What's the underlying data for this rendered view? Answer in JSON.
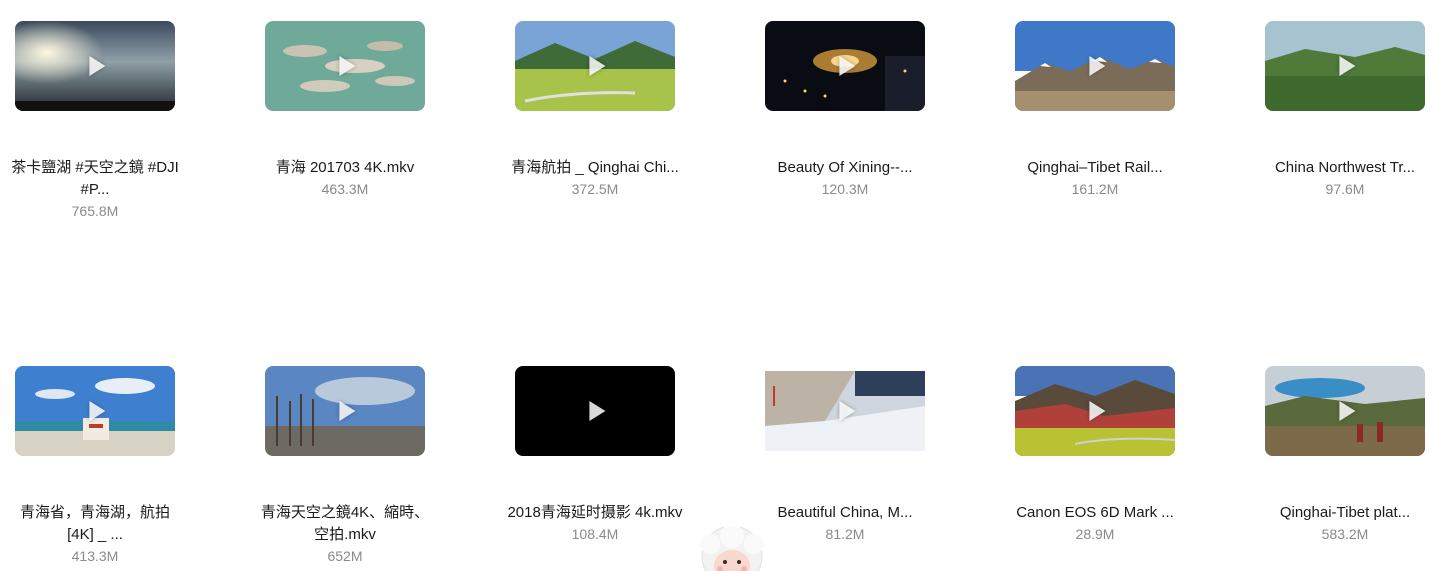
{
  "files": [
    {
      "title": "茶卡鹽湖 #天空之鏡 #DJI #P...",
      "size": "765.8M",
      "thumb": "thumb-salt-lake"
    },
    {
      "title": "青海 201703 4K.mkv",
      "size": "463.3M",
      "thumb": "thumb-lake-islands"
    },
    {
      "title": "青海航拍 _ Qinghai Chi...",
      "size": "372.5M",
      "thumb": "thumb-green-valley"
    },
    {
      "title": "Beauty Of Xining--...",
      "size": "120.3M",
      "thumb": "thumb-night-city"
    },
    {
      "title": "Qinghai–Tibet Rail...",
      "size": "161.2M",
      "thumb": "thumb-snow-mountains"
    },
    {
      "title": "China Northwest Tr...",
      "size": "97.6M",
      "thumb": "thumb-green-hills"
    },
    {
      "title": "青海省，青海湖，航拍 [4K] _ ...",
      "size": "413.3M",
      "thumb": "thumb-lake-shore"
    },
    {
      "title": "青海天空之鏡4K、縮時、空拍.mkv",
      "size": "652M",
      "thumb": "thumb-trees"
    },
    {
      "title": "2018青海延时摄影 4k.mkv",
      "size": "108.4M",
      "thumb": "thumb-black"
    },
    {
      "title": "Beautiful China, M...",
      "size": "81.2M",
      "thumb": "thumb-snow-field"
    },
    {
      "title": "Canon EOS 6D Mark ...",
      "size": "28.9M",
      "thumb": "thumb-canola-fields"
    },
    {
      "title": "Qinghai-Tibet plat...",
      "size": "583.2M",
      "thumb": "thumb-plateau-lake"
    }
  ],
  "icons": {
    "play": "play-icon",
    "mascot": "sheep-mascot-icon"
  }
}
